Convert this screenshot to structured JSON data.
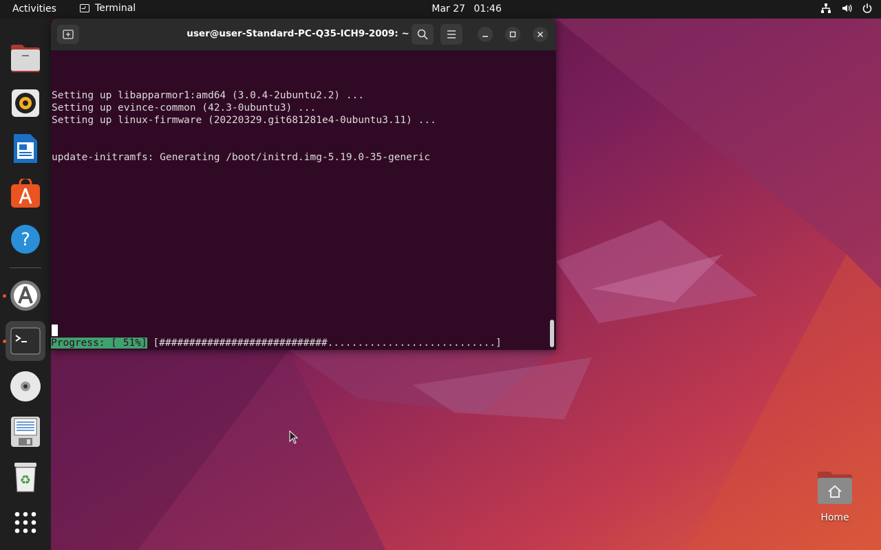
{
  "topbar": {
    "activities": "Activities",
    "app_name": "Terminal",
    "date": "Mar 27",
    "time": "01:46",
    "status_icons": [
      "network-icon",
      "volume-icon",
      "power-icon"
    ]
  },
  "dock": {
    "items": [
      {
        "name": "files",
        "icon": "file-manager-icon"
      },
      {
        "name": "rhythmbox",
        "icon": "speaker-icon"
      },
      {
        "name": "writer",
        "icon": "document-icon"
      },
      {
        "name": "app-center",
        "icon": "shopping-bag-icon"
      },
      {
        "name": "help",
        "icon": "help-icon"
      },
      {
        "name": "software-updater",
        "icon": "updater-icon",
        "running": true
      },
      {
        "name": "terminal",
        "icon": "terminal-icon",
        "running": true,
        "active": true
      },
      {
        "name": "disc",
        "icon": "cd-icon"
      },
      {
        "name": "save",
        "icon": "floppy-icon"
      },
      {
        "name": "trash",
        "icon": "recycle-bin-icon"
      },
      {
        "name": "show-apps",
        "icon": "grid-icon"
      }
    ]
  },
  "terminal": {
    "title": "user@user-Standard-PC-Q35-ICH9-2009: ~",
    "lines": [
      "Setting up libapparmor1:amd64 (3.0.4-2ubuntu2.2) ...",
      "Setting up evince-common (42.3-0ubuntu3) ...",
      "Setting up linux-firmware (20220329.git681281e4-0ubuntu3.11) ...",
      "",
      "",
      "update-initramfs: Generating /boot/initrd.img-5.19.0-35-generic"
    ],
    "progress_label": "Progress: [ 51%]",
    "progress_bar": " [############################............................]",
    "progress_percent": 51
  },
  "desktop": {
    "home_label": "Home"
  },
  "colors": {
    "terminal_bg": "#300a24",
    "progress_label_bg": "#3fa36d",
    "accent": "#e95420"
  }
}
